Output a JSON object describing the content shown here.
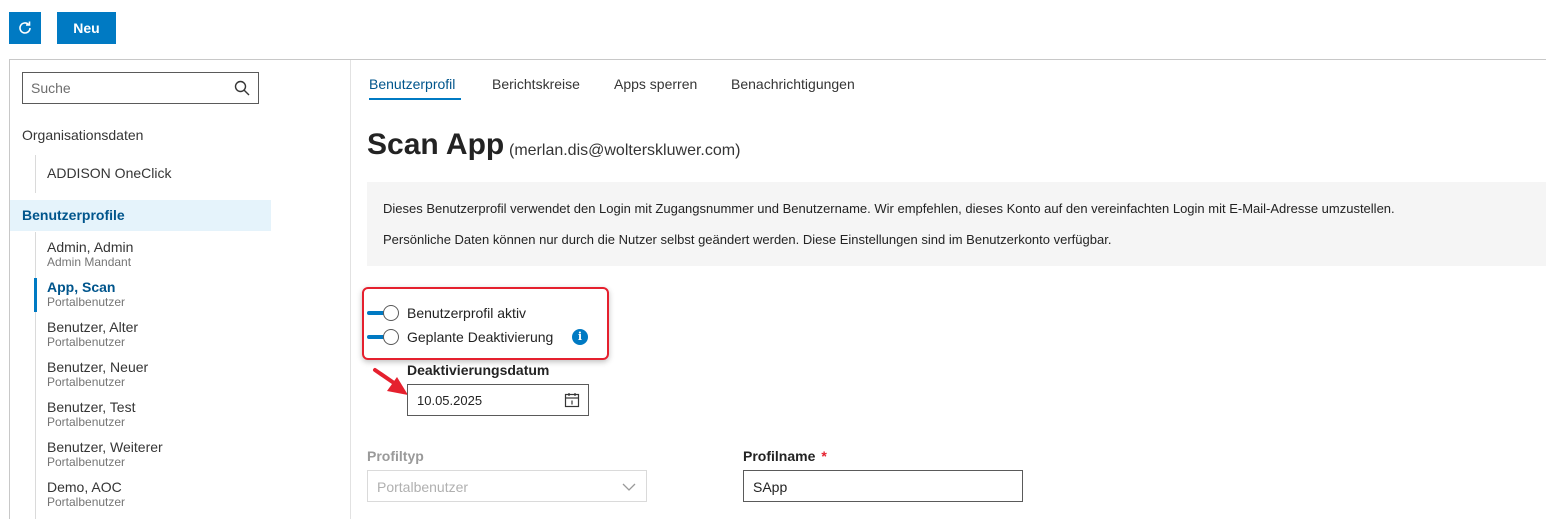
{
  "toolbar": {
    "new_label": "Neu",
    "refresh_icon": "refresh-icon",
    "accent": "#007ac3"
  },
  "sidebar": {
    "search_placeholder": "Suche",
    "org_heading": "Organisationsdaten",
    "org_item": "ADDISON OneClick",
    "profiles_heading": "Benutzerprofile",
    "users": [
      {
        "name": "Admin, Admin",
        "role": "Admin Mandant"
      },
      {
        "name": "App, Scan",
        "role": "Portalbenutzer"
      },
      {
        "name": "Benutzer, Alter",
        "role": "Portalbenutzer"
      },
      {
        "name": "Benutzer, Neuer",
        "role": "Portalbenutzer"
      },
      {
        "name": "Benutzer, Test",
        "role": "Portalbenutzer"
      },
      {
        "name": "Benutzer, Weiterer",
        "role": "Portalbenutzer"
      },
      {
        "name": "Demo, AOC",
        "role": "Portalbenutzer"
      }
    ]
  },
  "tabs": [
    "Benutzerprofil",
    "Berichtskreise",
    "Apps sperren",
    "Benachrichtigungen"
  ],
  "main": {
    "title": "Scan App",
    "email": "(merlan.dis@wolterskluwer.com)",
    "info_line_1": "Dieses Benutzerprofil verwendet den Login mit Zugangsnummer und Benutzername. Wir empfehlen, dieses Konto auf den vereinfachten Login mit E-Mail-Adresse umzustellen.",
    "info_line_2": "Persönliche Daten können nur durch die Nutzer selbst geändert werden. Diese Einstellungen sind im Benutzerkonto verfügbar.",
    "toggle_active_label": "Benutzerprofil aktiv",
    "toggle_deactivation_label": "Geplante Deaktivierung",
    "info_icon_glyph": "i",
    "date_label": "Deaktivierungsdatum",
    "date_value": "10.05.2025",
    "profiltyp_label": "Profiltyp",
    "profiltyp_value": "Portalbenutzer",
    "profilname_label": "Profilname",
    "profilname_required": "*",
    "profilname_value": "SApp"
  }
}
